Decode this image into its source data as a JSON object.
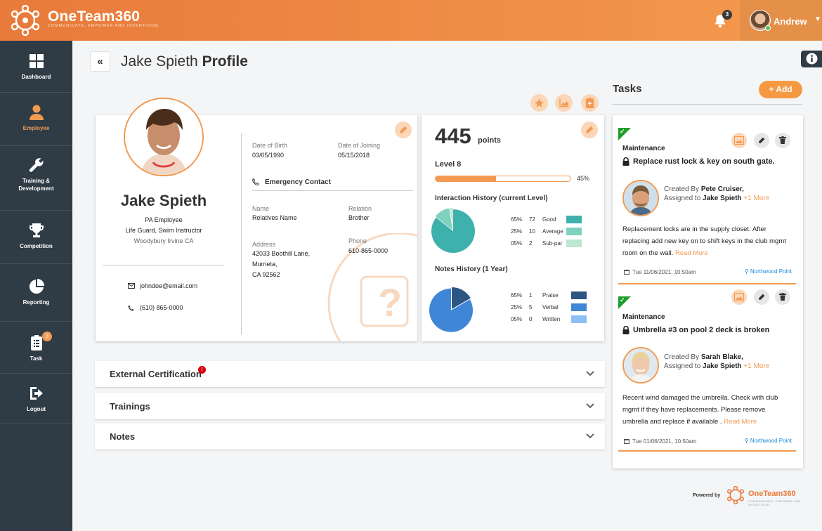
{
  "app": {
    "name": "OneTeam360",
    "tagline": "COMMUNICATE, EMPOWER AND INCENTIVIZE",
    "notifications_count": "3",
    "user_name": "Andrew"
  },
  "sidebar": {
    "items": [
      {
        "label": "Dashboard",
        "icon": "grid-icon"
      },
      {
        "label": "Employee",
        "icon": "user-icon",
        "active": true
      },
      {
        "label": "Training & Development",
        "icon": "wrench-icon"
      },
      {
        "label": "Competition",
        "icon": "trophy-icon"
      },
      {
        "label": "Reporting",
        "icon": "pie-chart-icon"
      },
      {
        "label": "Task",
        "icon": "clipboard-icon",
        "badge": "3"
      },
      {
        "label": "Logout",
        "icon": "logout-icon"
      }
    ]
  },
  "page": {
    "title_name": "Jake Spieth",
    "title_suffix": "Profile"
  },
  "profile": {
    "name": "Jake Spieth",
    "employee_type": "PA Employee",
    "roles": "Life Guard, Swim Instructor",
    "location": "Woodybury Irvine CA",
    "email": "johndoe@email.com",
    "phone": "(610) 865-0000",
    "dob_label": "Date of Birth",
    "dob": "03/05/1990",
    "doj_label": "Date of Joining",
    "doj": "05/15/2018",
    "emergency_title": "Emergency Contact",
    "ec_name_label": "Name",
    "ec_name": "Relatives Name",
    "ec_relation_label": "Relation",
    "ec_relation": "Brother",
    "ec_address_label": "Address",
    "ec_address_1": "42033 Boothill Lane,",
    "ec_address_2": "Murrieta,",
    "ec_address_3": "CA 92562",
    "ec_phone_label": "Phone",
    "ec_phone": "610-865-0000"
  },
  "points": {
    "value": "445",
    "label": "points",
    "level": "Level 8",
    "progress": 0.45,
    "progress_text": "45%",
    "interaction_title": "Interaction History (current Level)",
    "notes_title": "Notes History (1 Year)"
  },
  "chart_data": [
    {
      "type": "pie",
      "title": "Interaction History (current Level)",
      "categories": [
        "Good",
        "Average",
        "Sub-par"
      ],
      "values": [
        72,
        10,
        2
      ],
      "percent_labels": [
        "65%",
        "25%",
        "05%"
      ],
      "colors": [
        "#3fb1ad",
        "#7fd1bf",
        "#bfe6d3"
      ]
    },
    {
      "type": "pie",
      "title": "Notes History (1 Year)",
      "categories": [
        "Praise",
        "Verbal",
        "Written"
      ],
      "values": [
        1,
        5,
        0
      ],
      "percent_labels": [
        "65%",
        "25%",
        "05%"
      ],
      "colors": [
        "#2d5583",
        "#3f86d6",
        "#8cc0f2"
      ]
    }
  ],
  "accordions": [
    {
      "title": "External Certification",
      "badge": "!"
    },
    {
      "title": "Trainings"
    },
    {
      "title": "Notes"
    }
  ],
  "tasks": {
    "title": "Tasks",
    "add_label": "Add",
    "items": [
      {
        "category": "Maintenance",
        "title": "Replace rust lock & key on south gate.",
        "created_by_label": "Created By",
        "created_by": "Pete Cruiser,",
        "assigned_to_label": "Assigned to",
        "assigned_to": "Jake Spieth",
        "more": "+1 More",
        "description": "Replacement locks are in the supply closet. After replacing add new key on to shift keys in the club mgmt room on the wall.",
        "read_more": "Read More",
        "date": "Tue 11/06/2021, 10:50am",
        "location": "Northwood Point"
      },
      {
        "category": "Maintenance",
        "title": "Umbrella #3 on pool 2 deck is broken",
        "created_by_label": "Created By",
        "created_by": "Sarah Blake,",
        "assigned_to_label": "Assigned to",
        "assigned_to": "Jake Spieth",
        "more": "+1 More",
        "description": "Recent wind damaged the umbrella. Check with club mgmt if they have replacements. Please remove umbrella and replace if available .",
        "read_more": "Read More",
        "date": "Tue 01/06/2021, 10:50am",
        "location": "Northwood Point"
      }
    ]
  },
  "footer": {
    "powered_by": "Powered by",
    "brand": "OneTeam360",
    "tagline": "COMMUNICATE, EMPOWER AND INCENTIVIZE"
  },
  "colors": {
    "accent": "#f29a52",
    "sidebar": "#2f3b45",
    "success": "#1e9e2b",
    "link": "#1a8ad8",
    "error": "#d9000d"
  }
}
